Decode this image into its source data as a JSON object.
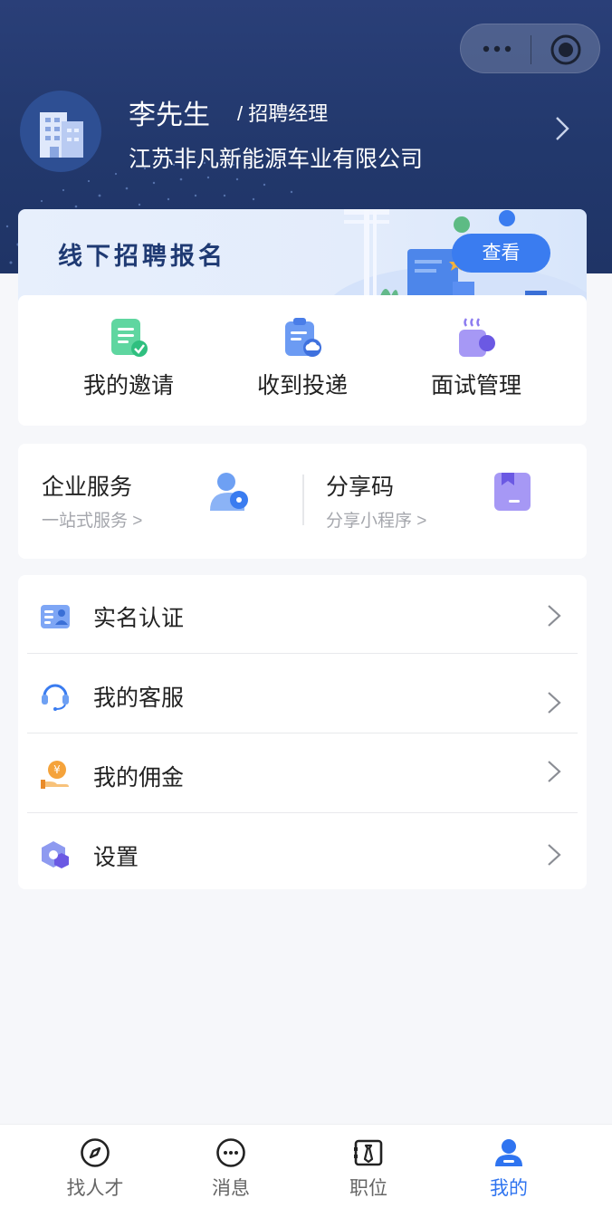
{
  "profile": {
    "name": "李先生",
    "role": "/ 招聘经理",
    "company": "江苏非凡新能源车业有限公司"
  },
  "banner": {
    "title": "线下招聘报名",
    "button_label": "查看"
  },
  "shortcuts": [
    {
      "label": "我的邀请",
      "icon": "invitation-icon",
      "color": "#4fd49a"
    },
    {
      "label": "收到投递",
      "icon": "clipboard-icon",
      "color": "#5a8ff2"
    },
    {
      "label": "面试管理",
      "icon": "coffee-cup-icon",
      "color": "#8c7cf0"
    }
  ],
  "services": [
    {
      "title": "企业服务",
      "subtitle": "一站式服务 >",
      "icon": "user-service-icon"
    },
    {
      "title": "分享码",
      "subtitle": "分享小程序 >",
      "icon": "share-code-icon"
    }
  ],
  "menu": [
    {
      "label": "实名认证",
      "icon": "id-card-icon"
    },
    {
      "label": "我的客服",
      "icon": "headset-icon"
    },
    {
      "label": "我的佣金",
      "icon": "coin-hand-icon"
    },
    {
      "label": "设置",
      "icon": "settings-hexagon-icon"
    }
  ],
  "tabbar": [
    {
      "label": "找人才",
      "icon": "compass-icon",
      "active": false
    },
    {
      "label": "消息",
      "icon": "chat-icon",
      "active": false
    },
    {
      "label": "职位",
      "icon": "briefcase-icon",
      "active": false
    },
    {
      "label": "我的",
      "icon": "user-icon",
      "active": true
    }
  ],
  "colors": {
    "header_bg": "#22386c",
    "accent": "#2f74f0",
    "page_bg": "#f6f7fa"
  }
}
